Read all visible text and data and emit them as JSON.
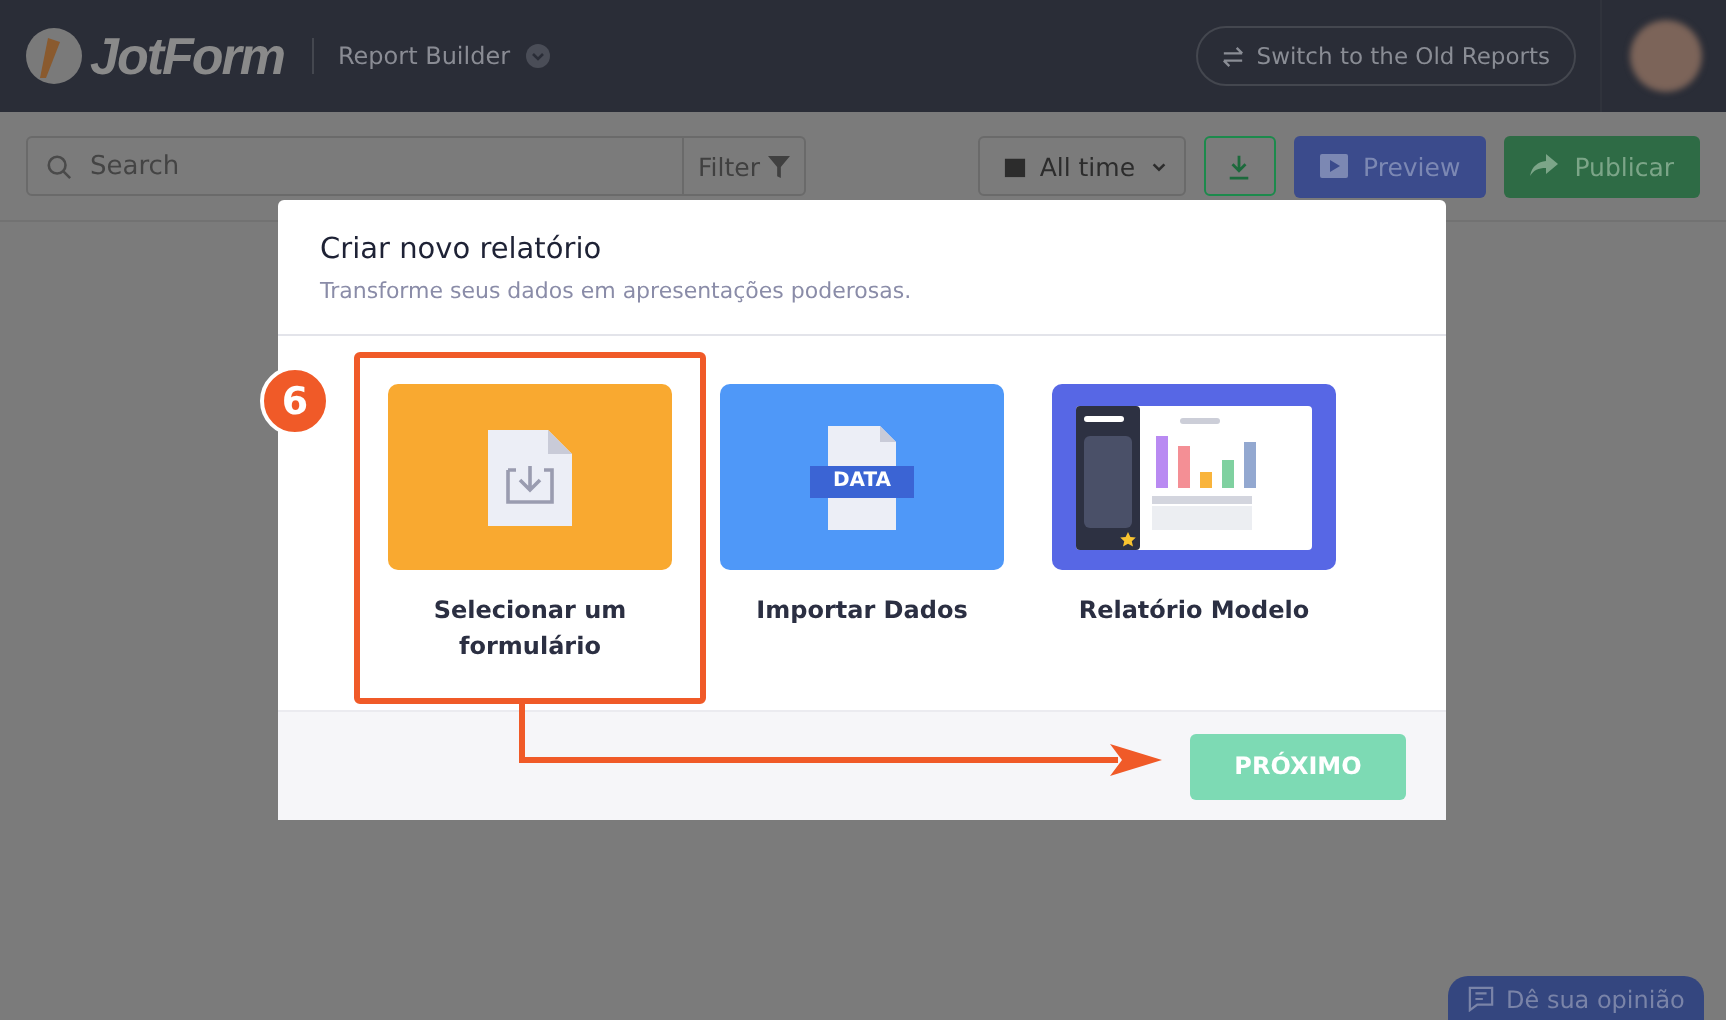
{
  "header": {
    "logo": "JotForm",
    "app_title": "Report Builder",
    "switch_button": "Switch to the Old Reports"
  },
  "toolbar": {
    "search": {
      "placeholder": "Search"
    },
    "filter": "Filter",
    "date_range": "All time",
    "preview": "Preview",
    "publish": "Publicar"
  },
  "dialog": {
    "title": "Criar novo relatório",
    "subtitle": "Transforme seus dados em apresentações poderosas.",
    "options": [
      {
        "kind": "form",
        "label": "Selecionar um formulário"
      },
      {
        "kind": "data",
        "label": "Importar Dados",
        "badge": "DATA"
      },
      {
        "kind": "template",
        "label": "Relatório Modelo"
      }
    ],
    "next_button": "PRÓXIMO"
  },
  "annotation": {
    "step": "6"
  },
  "feedback_button": "Dê sua opinião"
}
